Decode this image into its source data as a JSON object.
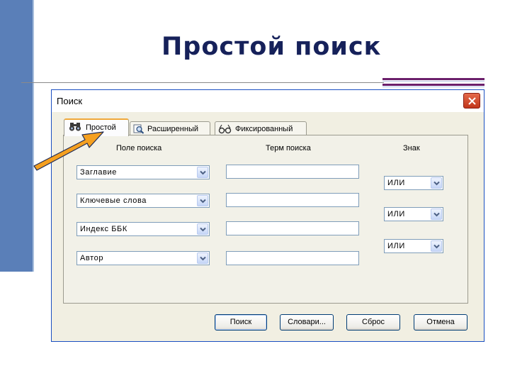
{
  "slide": {
    "title": "Простой поиск"
  },
  "dialog": {
    "title": "Поиск",
    "tabs": [
      {
        "label": "Простой",
        "icon": "binoculars-icon",
        "active": true
      },
      {
        "label": "Расширенный",
        "icon": "magnifier-icon",
        "active": false
      },
      {
        "label": "Фиксированный",
        "icon": "glasses-icon",
        "active": false
      }
    ],
    "columns": {
      "field": "Поле поиска",
      "term": "Терм поиска",
      "operator": "Знак"
    },
    "rows": [
      {
        "field": "Заглавие",
        "term": ""
      },
      {
        "field": "Ключевые слова",
        "term": ""
      },
      {
        "field": "Индекс ББК",
        "term": ""
      },
      {
        "field": "Автор",
        "term": ""
      }
    ],
    "operators": [
      "ИЛИ",
      "ИЛИ",
      "ИЛИ"
    ],
    "buttons": {
      "search": "Поиск",
      "dictionaries": "Словари...",
      "reset": "Сброс",
      "cancel": "Отмена"
    }
  },
  "colors": {
    "slide_bar": "#5a7fb8",
    "title_text": "#16215a",
    "accent_purple": "#6b1f6b",
    "annotation_arrow": "#f5a020"
  }
}
